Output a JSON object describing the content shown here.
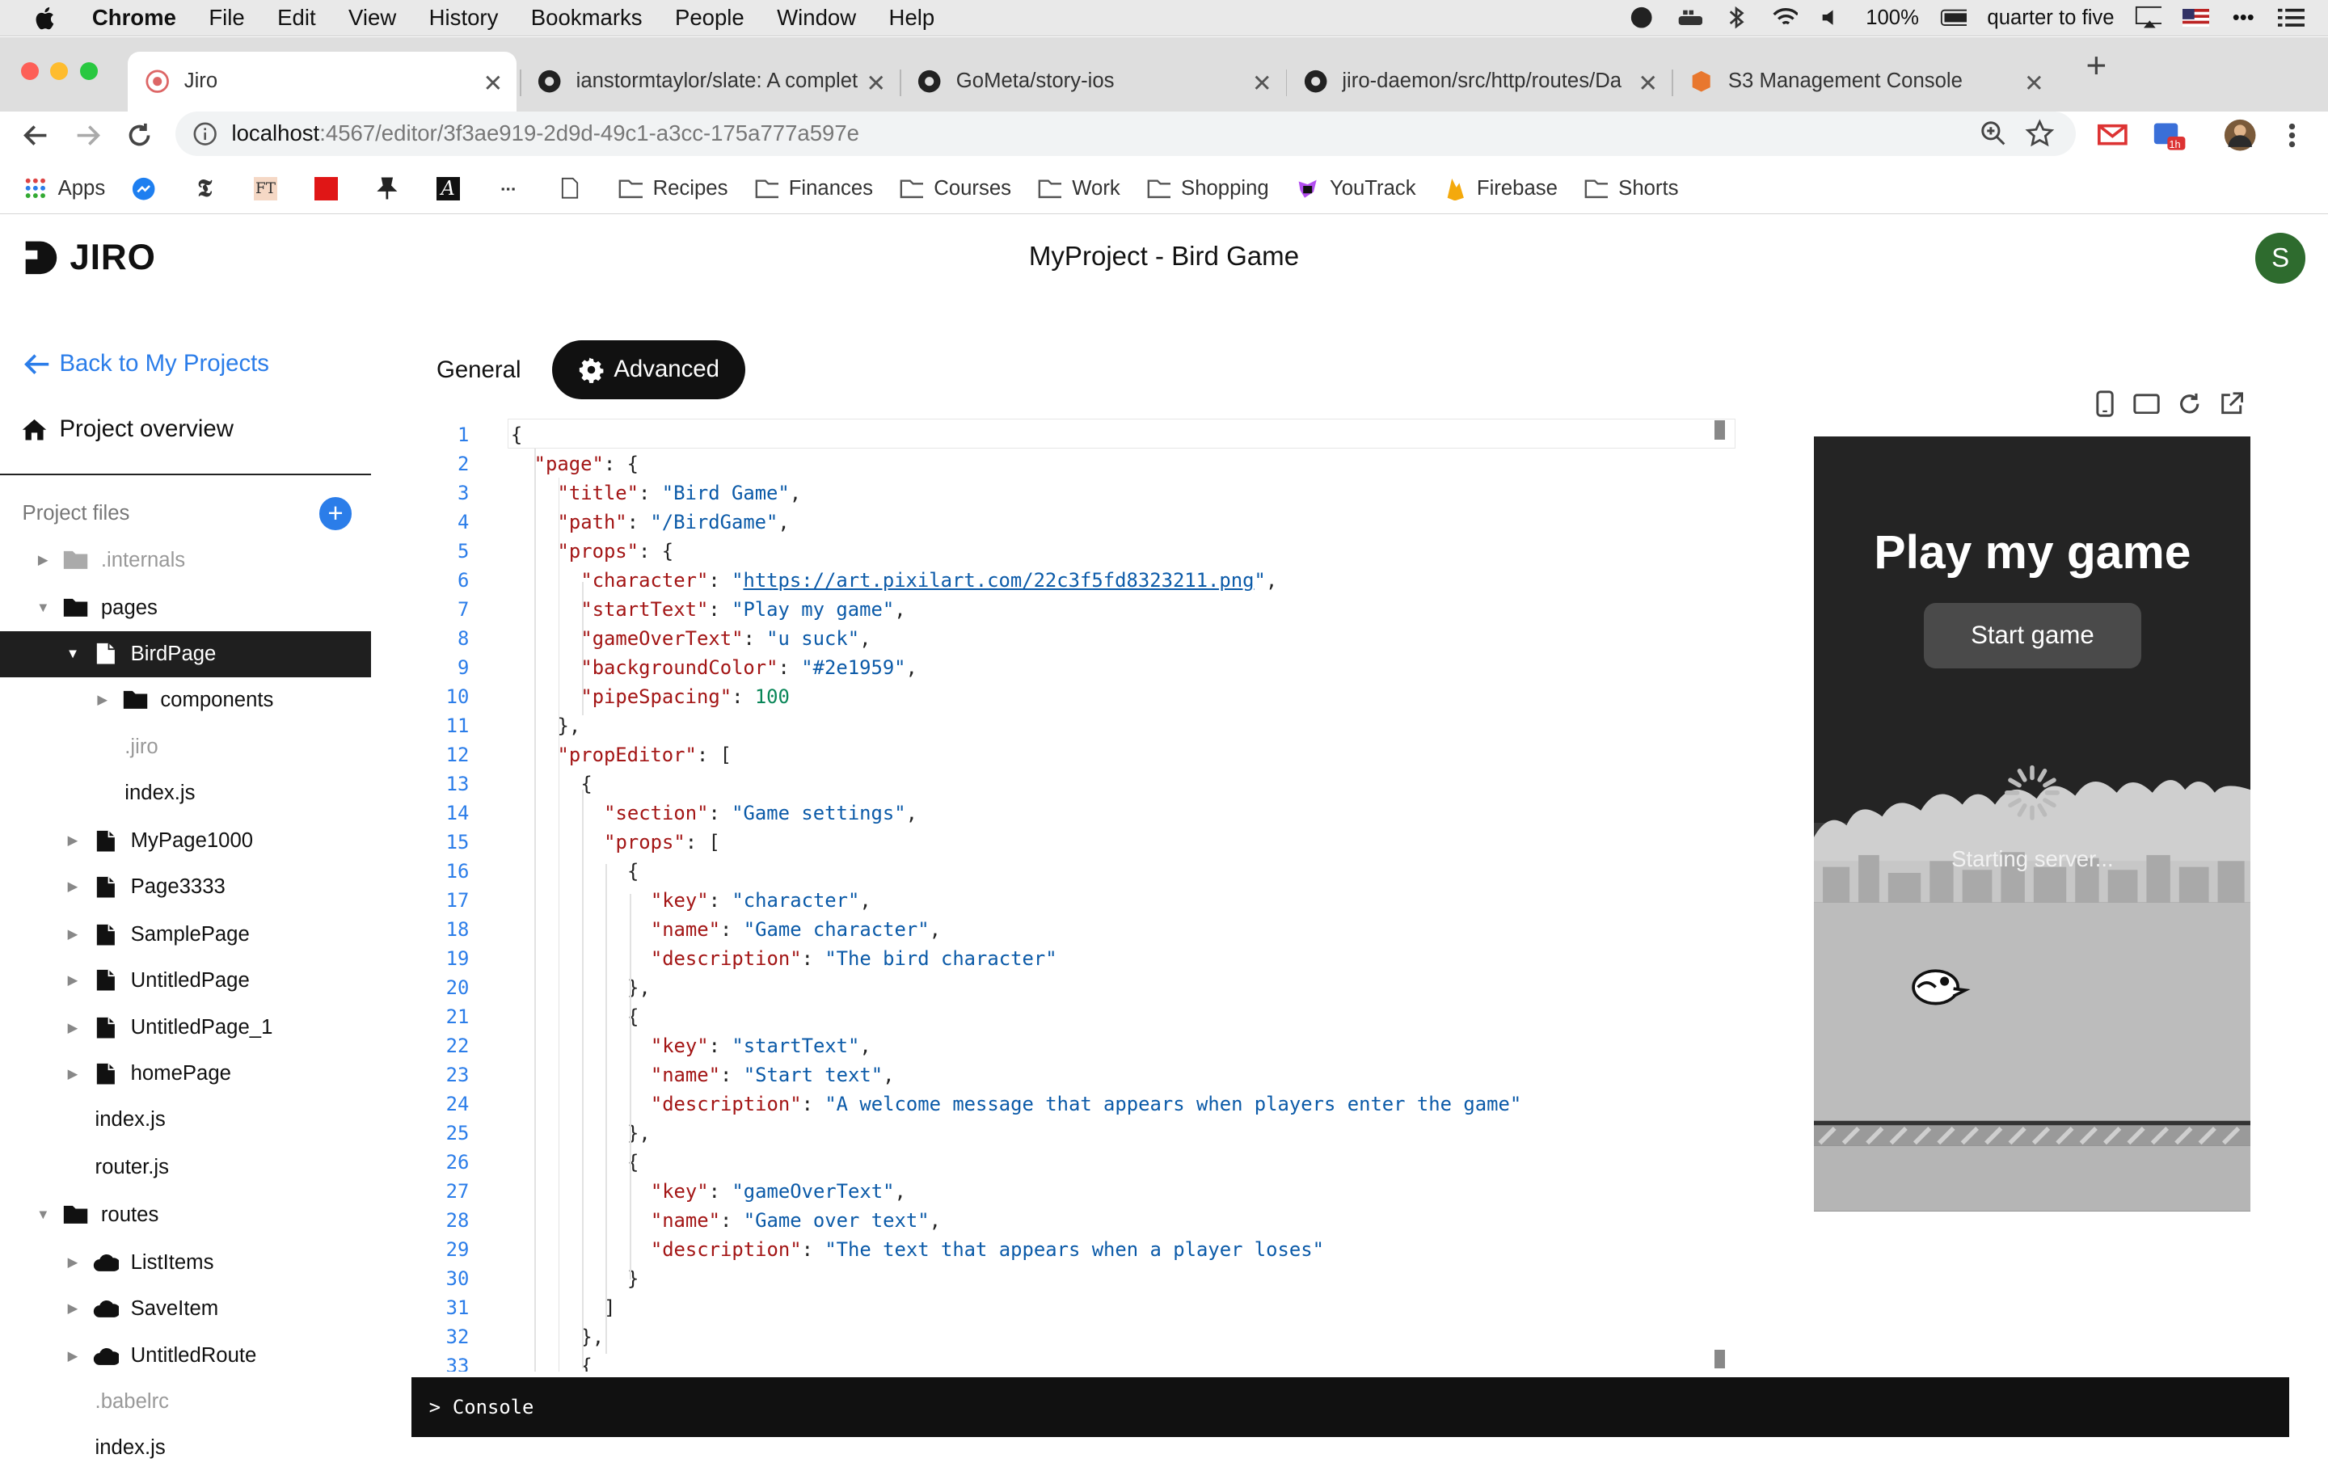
{
  "menubar": {
    "app": "Chrome",
    "items": [
      "File",
      "Edit",
      "View",
      "History",
      "Bookmarks",
      "People",
      "Window",
      "Help"
    ],
    "battery": "100%",
    "clock": "quarter to five"
  },
  "tabs": [
    {
      "title": "Jiro"
    },
    {
      "title": "ianstormtaylor/slate: A complete"
    },
    {
      "title": "GoMeta/story-ios"
    },
    {
      "title": "jiro-daemon/src/http/routes/Da"
    },
    {
      "title": "S3 Management Console"
    }
  ],
  "address": {
    "host": "localhost",
    "path": ":4567/editor/3f3ae919-2d9d-49c1-a3cc-175a777a597e"
  },
  "extensions": {
    "badge": "1h"
  },
  "bookmarks": {
    "apps": "Apps",
    "ft": "FT",
    "folders": [
      "Recipes",
      "Finances",
      "Courses",
      "Work",
      "Shopping"
    ],
    "youtrack": "YouTrack",
    "firebase": "Firebase",
    "shorts": "Shorts"
  },
  "app": {
    "logo": "JIRO",
    "project_title": "MyProject - Bird Game",
    "avatar": "S"
  },
  "sidebar": {
    "back": "Back to My Projects",
    "overview": "Project overview",
    "files_label": "Project files",
    "add": "+",
    "tree": [
      {
        "label": ".internals"
      },
      {
        "label": "pages"
      },
      {
        "label": "BirdPage"
      },
      {
        "label": "components"
      },
      {
        "label": ".jiro"
      },
      {
        "label": "index.js"
      },
      {
        "label": "MyPage1000"
      },
      {
        "label": "Page3333"
      },
      {
        "label": "SamplePage"
      },
      {
        "label": "UntitledPage"
      },
      {
        "label": "UntitledPage_1"
      },
      {
        "label": "homePage"
      },
      {
        "label": "index.js"
      },
      {
        "label": "router.js"
      },
      {
        "label": "routes"
      },
      {
        "label": "ListItems"
      },
      {
        "label": "SaveItem"
      },
      {
        "label": "UntitledRoute"
      },
      {
        "label": ".babelrc"
      },
      {
        "label": "index.js"
      }
    ]
  },
  "editor_tabs": {
    "general": "General",
    "advanced": "Advanced"
  },
  "code": [
    {
      "n": "1"
    },
    {
      "n": "2"
    },
    {
      "n": "3"
    },
    {
      "n": "4"
    },
    {
      "n": "5"
    },
    {
      "n": "6"
    },
    {
      "n": "7"
    },
    {
      "n": "8"
    },
    {
      "n": "9"
    },
    {
      "n": "10"
    },
    {
      "n": "11"
    },
    {
      "n": "12"
    },
    {
      "n": "13"
    },
    {
      "n": "14"
    },
    {
      "n": "15"
    },
    {
      "n": "16"
    },
    {
      "n": "17"
    },
    {
      "n": "18"
    },
    {
      "n": "19"
    },
    {
      "n": "20"
    },
    {
      "n": "21"
    },
    {
      "n": "22"
    },
    {
      "n": "23"
    },
    {
      "n": "24"
    },
    {
      "n": "25"
    },
    {
      "n": "26"
    },
    {
      "n": "27"
    },
    {
      "n": "28"
    },
    {
      "n": "29"
    },
    {
      "n": "30"
    },
    {
      "n": "31"
    },
    {
      "n": "32"
    },
    {
      "n": "33"
    }
  ],
  "code_tokens": {
    "page": "\"page\"",
    "title_key": "\"title\"",
    "title_val": "\"Bird Game\"",
    "path_key": "\"path\"",
    "path_val": "\"/BirdGame\"",
    "props_key": "\"props\"",
    "character_key": "\"character\"",
    "character_url": "https://art.pixilart.com/22c3f5fd8323211.png",
    "startText_key": "\"startText\"",
    "startText_val": "\"Play my game\"",
    "gameOverText_key": "\"gameOverText\"",
    "gameOverText_val": "\"u suck\"",
    "backgroundColor_key": "\"backgroundColor\"",
    "backgroundColor_val": "\"#2e1959\"",
    "pipeSpacing_key": "\"pipeSpacing\"",
    "pipeSpacing_val": "100",
    "propEditor_key": "\"propEditor\"",
    "section_key": "\"section\"",
    "section_val": "\"Game settings\"",
    "key_key": "\"key\"",
    "name_key": "\"name\"",
    "description_key": "\"description\"",
    "k1": "\"character\"",
    "n1": "\"Game character\"",
    "d1": "\"The bird character\"",
    "k2": "\"startText\"",
    "n2": "\"Start text\"",
    "d2": "\"A welcome message that appears when players enter the game\"",
    "k3": "\"gameOverText\"",
    "n3": "\"Game over text\"",
    "d3": "\"The text that appears when a player loses\""
  },
  "console": {
    "label": "Console"
  },
  "preview": {
    "title": "Play my game",
    "button": "Start game",
    "status": "Starting server..."
  },
  "colors": {
    "accent": "#2b7de9",
    "avatar": "#2e6b2e",
    "preview_dark": "#242424"
  }
}
